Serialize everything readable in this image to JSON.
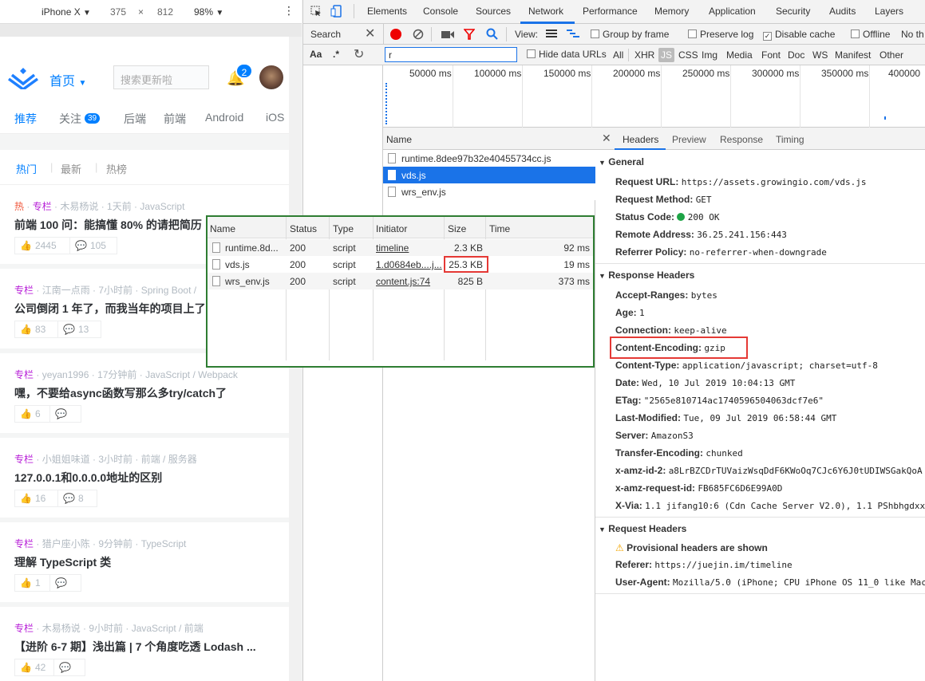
{
  "device": {
    "name": "iPhone X",
    "arrow": "▼",
    "width": "375",
    "times": "×",
    "height": "812",
    "zoom": "98%",
    "more": "⋮"
  },
  "juejin": {
    "home_label": "首页",
    "search_placeholder": "搜索更新啦",
    "notif_count": "2",
    "nav": [
      "推荐",
      "关注",
      "后端",
      "前端",
      "Android",
      "iOS"
    ],
    "follow_badge": "39",
    "subtabs": [
      "热门",
      "最新",
      "热榜"
    ],
    "feed": [
      {
        "tag": "热",
        "section": "专栏",
        "meta": "· 木易杨说 · 1天前 · JavaScript",
        "title": "前端 100 问：能搞懂 80% 的请把简历",
        "likes": "2445",
        "comments": "105"
      },
      {
        "tag": "",
        "section": "专栏",
        "meta": "· 江南一点雨 · 7小时前 · Spring Boot /",
        "title": "公司倒闭 1 年了，而我当年的项目上了",
        "likes": "83",
        "comments": "13"
      },
      {
        "tag": "",
        "section": "专栏",
        "meta": "· yeyan1996 · 17分钟前 · JavaScript / Webpack",
        "title": "嘿，不要给async函数写那么多try/catch了",
        "likes": "6",
        "comments": ""
      },
      {
        "tag": "",
        "section": "专栏",
        "meta": "· 小姐姐味道 · 3小时前 · 前端 / 服务器",
        "title": "127.0.0.1和0.0.0.0地址的区别",
        "likes": "16",
        "comments": "8"
      },
      {
        "tag": "",
        "section": "专栏",
        "meta": "· 猎户座小陈 · 9分钟前 · TypeScript",
        "title": "理解 TypeScript 类",
        "likes": "1",
        "comments": ""
      },
      {
        "tag": "",
        "section": "专栏",
        "meta": "· 木易杨说 · 9小时前 · JavaScript / 前端",
        "title": "【进阶 6-7 期】浅出篇 | 7 个角度吃透 Lodash ...",
        "likes": "42",
        "comments": ""
      }
    ]
  },
  "devtools": {
    "tabs": [
      "Elements",
      "Console",
      "Sources",
      "Network",
      "Performance",
      "Memory",
      "Application",
      "Security",
      "Audits",
      "Layers"
    ],
    "active_tab": "Network",
    "search_label": "Search",
    "view_label": "View:",
    "group_by_frame": "Group by frame",
    "preserve_log": "Preserve log",
    "disable_cache": "Disable cache",
    "offline": "Offline",
    "no_throttle": "No th",
    "filter_value": "r",
    "hide_data_urls": "Hide data URLs",
    "types": [
      "All",
      "XHR",
      "JS",
      "CSS",
      "Img",
      "Media",
      "Font",
      "Doc",
      "WS",
      "Manifest",
      "Other"
    ],
    "aa": "Aa",
    "regex": ".*",
    "ticks": [
      "50000 ms",
      "100000 ms",
      "150000 ms",
      "200000 ms",
      "250000 ms",
      "300000 ms",
      "350000 ms",
      "400000"
    ],
    "name_header": "Name",
    "files": [
      "runtime.8dee97b32e40455734cc.js",
      "vds.js",
      "wrs_env.js"
    ],
    "detail_tabs": [
      "Headers",
      "Preview",
      "Response",
      "Timing"
    ],
    "general_title": "General",
    "general": [
      [
        "Request URL:",
        "https://assets.growingio.com/vds.js"
      ],
      [
        "Request Method:",
        "GET"
      ],
      [
        "Status Code:",
        "200 OK"
      ],
      [
        "Remote Address:",
        "36.25.241.156:443"
      ],
      [
        "Referrer Policy:",
        "no-referrer-when-downgrade"
      ]
    ],
    "response_title": "Response Headers",
    "response": [
      [
        "Accept-Ranges:",
        "bytes"
      ],
      [
        "Age:",
        "1"
      ],
      [
        "Connection:",
        "keep-alive"
      ],
      [
        "Content-Encoding:",
        "gzip"
      ],
      [
        "Content-Type:",
        "application/javascript; charset=utf-8"
      ],
      [
        "Date:",
        "Wed, 10 Jul 2019 10:04:13 GMT"
      ],
      [
        "ETag:",
        "\"2565e810714ac1740596504063dcf7e6\""
      ],
      [
        "Last-Modified:",
        "Tue, 09 Jul 2019 06:58:44 GMT"
      ],
      [
        "Server:",
        "AmazonS3"
      ],
      [
        "Transfer-Encoding:",
        "chunked"
      ],
      [
        "x-amz-id-2:",
        "a8LrBZCDrTUVaizWsqDdF6KWoOq7CJc6Y6J0tUDIWSGakQoA"
      ],
      [
        "x-amz-request-id:",
        "FB685FC6D6E99A0D"
      ],
      [
        "X-Via:",
        "1.1 jifang10:6 (Cdn Cache Server V2.0), 1.1 PShbhgdxx"
      ]
    ],
    "request_title": "Request Headers",
    "provisional": "Provisional headers are shown",
    "request": [
      [
        "Referer:",
        "https://juejin.im/timeline"
      ],
      [
        "User-Agent:",
        "Mozilla/5.0 (iPhone; CPU iPhone OS 11_0 like Mac"
      ]
    ],
    "status_color": "#1ea446"
  },
  "table": {
    "headers": [
      "Name",
      "Status",
      "Type",
      "Initiator",
      "Size",
      "Time"
    ],
    "rows": [
      [
        "runtime.8d...",
        "200",
        "script",
        "timeline",
        "2.3 KB",
        "92 ms"
      ],
      [
        "vds.js",
        "200",
        "script",
        "1.d0684eb....j...",
        "25.3 KB",
        "19 ms"
      ],
      [
        "wrs_env.js",
        "200",
        "script",
        "content.js:74",
        "825 B",
        "373 ms"
      ]
    ]
  }
}
